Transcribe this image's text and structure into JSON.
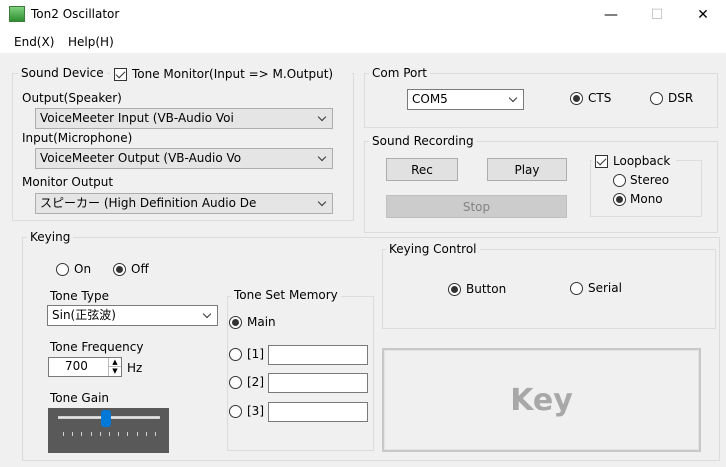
{
  "window": {
    "title": "Ton2 Oscillator",
    "minimize": "—",
    "maximize": "☐",
    "close": "✕"
  },
  "menu": {
    "end": "End(X)",
    "help": "Help(H)"
  },
  "sound_device": {
    "group_label": "Sound Device",
    "tone_monitor_label": "Tone Monitor(Input => M.Output)",
    "tone_monitor_checked": true,
    "output_label": "Output(Speaker)",
    "output_value": "VoiceMeeter Input (VB-Audio Voi",
    "input_label": "Input(Microphone)",
    "input_value": "VoiceMeeter Output (VB-Audio Vo",
    "monitor_label": "Monitor Output",
    "monitor_value": "スピーカー (High Definition Audio De"
  },
  "com_port": {
    "group_label": "Com Port",
    "port_value": "COM5",
    "cts_label": "CTS",
    "dsr_label": "DSR",
    "selected": "CTS"
  },
  "sound_recording": {
    "group_label": "Sound Recording",
    "rec_label": "Rec",
    "play_label": "Play",
    "stop_label": "Stop",
    "loopback_label": "Loopback",
    "loopback_checked": true,
    "stereo_label": "Stereo",
    "mono_label": "Mono",
    "selected": "Mono"
  },
  "keying": {
    "group_label": "Keying",
    "on_label": "On",
    "off_label": "Off",
    "selected": "Off",
    "tone_type_label": "Tone Type",
    "tone_type_value": "Sin(正弦波)",
    "tone_frequency_label": "Tone Frequency",
    "tone_frequency_value": "700",
    "hz_label": "Hz",
    "tone_gain_label": "Tone Gain",
    "tone_gain_level": 0.47
  },
  "tone_set_memory": {
    "group_label": "Tone Set Memory",
    "main_label": "Main",
    "slot1_label": "[1]",
    "slot2_label": "[2]",
    "slot3_label": "[3]",
    "slot1_value": "",
    "slot2_value": "",
    "slot3_value": "",
    "selected": "Main"
  },
  "keying_control": {
    "group_label": "Keying Control",
    "button_label": "Button",
    "serial_label": "Serial",
    "selected": "Button",
    "key_label": "Key"
  }
}
